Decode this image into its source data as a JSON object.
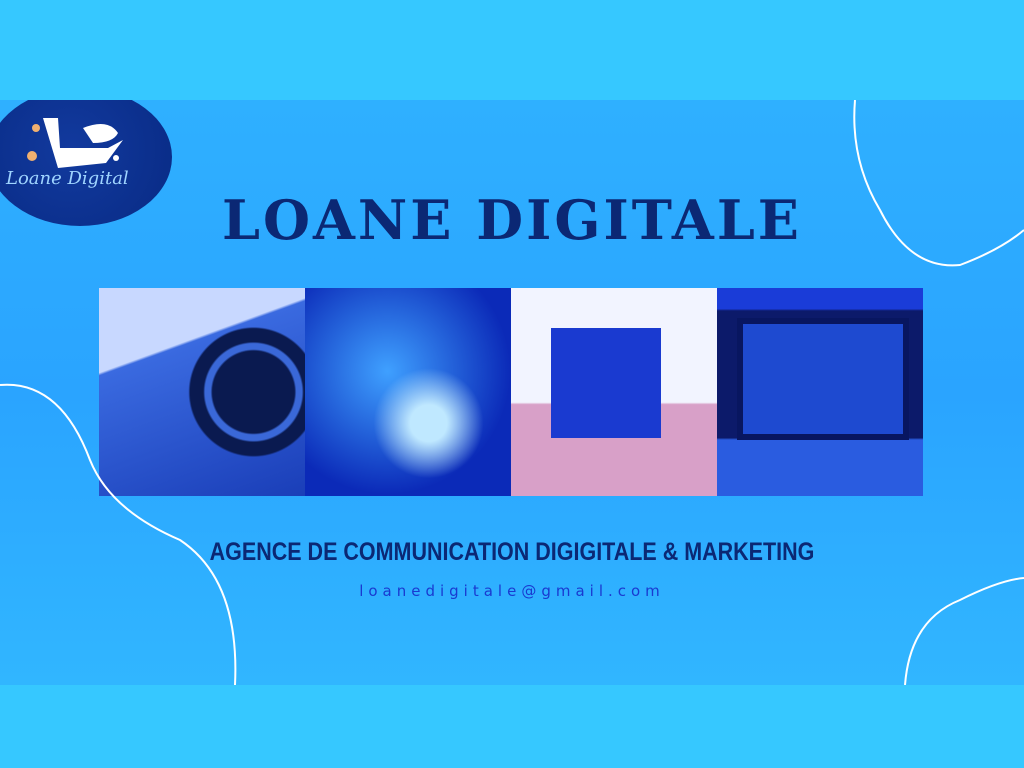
{
  "logo": {
    "script_text": "Loane Digital"
  },
  "title": "LOANE DIGITALE",
  "photos": [
    {
      "name": "camera-laptop-photo"
    },
    {
      "name": "digital-network-photo"
    },
    {
      "name": "photo-studio-photo"
    },
    {
      "name": "video-monitor-photo"
    }
  ],
  "subtitle": "AGENCE DE COMMUNICATION DIGIGITALE & MARKETING",
  "email": "loanedigitale@gmail.com",
  "colors": {
    "background": "#36c8ff",
    "banner": "#2aa4ff",
    "text": "#0b2874",
    "email": "#1a3ad0",
    "logo": "#082a84"
  }
}
